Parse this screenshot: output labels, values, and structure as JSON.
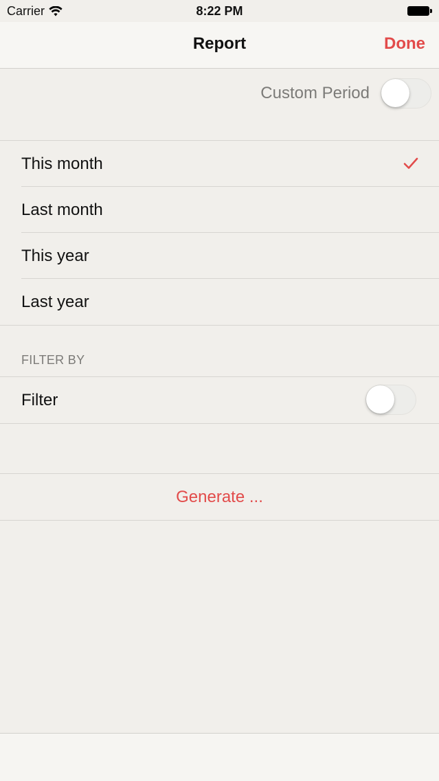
{
  "status_bar": {
    "carrier": "Carrier",
    "time": "8:22 PM"
  },
  "nav": {
    "title": "Report",
    "done_label": "Done"
  },
  "custom_period": {
    "label": "Custom Period",
    "enabled": false
  },
  "periods": [
    {
      "label": "This month",
      "selected": true
    },
    {
      "label": "Last month",
      "selected": false
    },
    {
      "label": "This year",
      "selected": false
    },
    {
      "label": "Last year",
      "selected": false
    }
  ],
  "filter_section": {
    "header": "FILTER BY",
    "filter_label": "Filter",
    "enabled": false
  },
  "generate": {
    "label": "Generate ..."
  },
  "colors": {
    "accent": "#e24b4a",
    "background": "#f1efeb",
    "secondary_text": "#7c7b78"
  }
}
